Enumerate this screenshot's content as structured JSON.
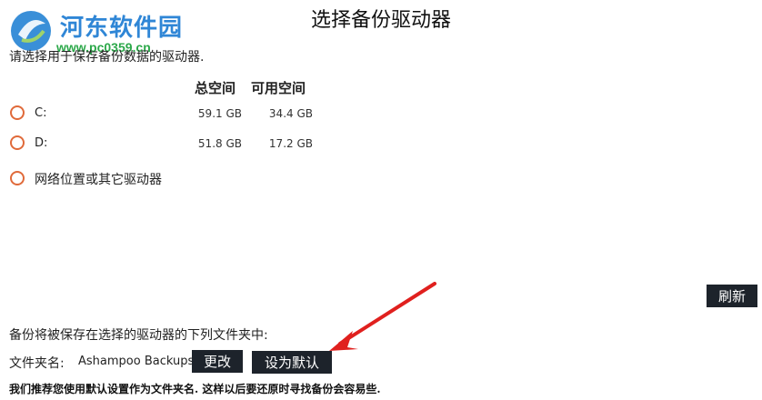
{
  "watermark": {
    "site_name": "河东软件园",
    "site_url": "www.pc0359.cn"
  },
  "dialog": {
    "title": "选择备份驱动器",
    "prompt": "请选择用于保存备份数据的驱动器."
  },
  "drives": {
    "headers": {
      "total": "总空间",
      "free": "可用空间"
    },
    "items": [
      {
        "label": "C:",
        "total": "59.1 GB",
        "free": "34.4 GB"
      },
      {
        "label": "D:",
        "total": "51.8 GB",
        "free": "17.2 GB"
      }
    ],
    "network_option": "网络位置或其它驱动器"
  },
  "buttons": {
    "refresh": "刷新",
    "change": "更改",
    "set_default": "设为默认"
  },
  "folder": {
    "save_note": "备份将被保存在选择的驱动器的下列文件夹中:",
    "label": "文件夹名:",
    "value": "Ashampoo Backups"
  },
  "recommendation": "我们推荐您使用默认设置作为文件夹名. 这样以后要还原时寻找备份会容易些.",
  "colors": {
    "radio_border": "#e06a3a",
    "button_bg": "#1d232b",
    "arrow": "#e0201e",
    "watermark_blue": "#2f86d6",
    "watermark_green": "#2ca84a"
  }
}
